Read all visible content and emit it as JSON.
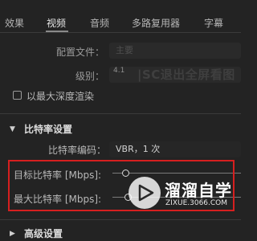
{
  "tabs": [
    {
      "label": "效果",
      "active": false
    },
    {
      "label": "视频",
      "active": true
    },
    {
      "label": "音频",
      "active": false
    },
    {
      "label": "多路复用器",
      "active": false
    },
    {
      "label": "字幕",
      "active": false
    }
  ],
  "profile": {
    "label": "配置文件：",
    "value": "主要"
  },
  "level": {
    "label": "级别：",
    "value": "4.1"
  },
  "overlay_text": "|SC退出全屏看图",
  "max_depth": {
    "label": "以最大深度渲染",
    "checked": false
  },
  "bitrate_section": {
    "title": "比特率设置",
    "encoding_label": "比特率编码：",
    "encoding_value": "VBR，1 次",
    "target_label": "目标比特率 [Mbps]:",
    "max_label": "最大比特率 [Mbps]:",
    "target_value_fraction": 0.1,
    "max_value_fraction": 0.12
  },
  "advanced_section": {
    "title": "高级设置"
  },
  "watermark": {
    "title": "溜溜自学",
    "url": "ZIXUE.3066.COM"
  },
  "colors": {
    "highlight": "#d61f1f",
    "background": "#232323"
  }
}
